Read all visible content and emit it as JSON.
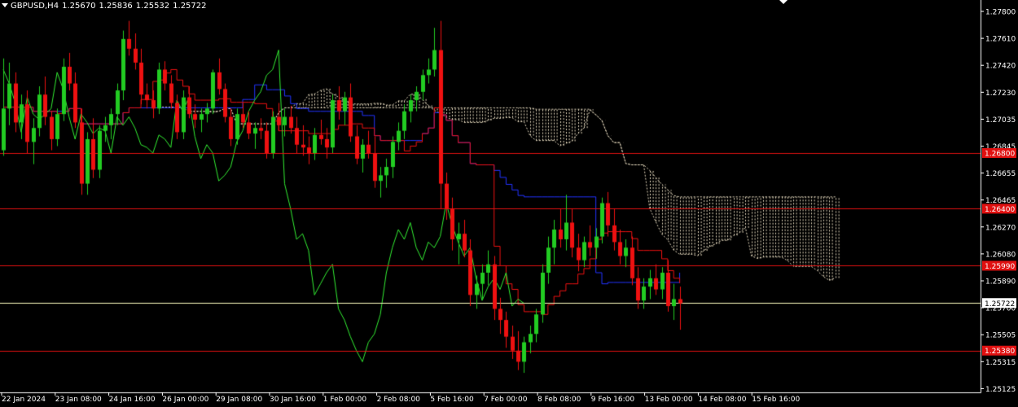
{
  "window": {
    "symbol": "GBPUSD,H4",
    "ohlc": [
      "1.25670",
      "1.25836",
      "1.25532",
      "1.25722"
    ]
  },
  "chart_data": {
    "type": "candlestick",
    "ylim": [
      1.2508,
      1.279
    ],
    "yticks": [
      "1.27800",
      "1.27610",
      "1.27420",
      "1.27230",
      "1.27035",
      "1.26845",
      "1.26655",
      "1.26465",
      "1.26270",
      "1.26080",
      "1.25890",
      "1.25700",
      "1.25505",
      "1.25315",
      "1.25125"
    ],
    "xticks": [
      "22 Jan 2024",
      "23 Jan 08:00",
      "24 Jan 16:00",
      "26 Jan 00:00",
      "29 Jan 08:00",
      "30 Jan 16:00",
      "1 Feb 00:00",
      "2 Feb 08:00",
      "5 Feb 16:00",
      "7 Feb 00:00",
      "8 Feb 08:00",
      "9 Feb 16:00",
      "13 Feb 00:00",
      "14 Feb 08:00",
      "15 Feb 16:00"
    ],
    "horizontal_levels": [
      {
        "value": 1.268,
        "label": "1.26800",
        "color": "#e01010"
      },
      {
        "value": 1.264,
        "label": "1.26400",
        "color": "#e01010"
      },
      {
        "value": 1.2599,
        "label": "1.25990",
        "color": "#e01010"
      },
      {
        "value": 1.2538,
        "label": "1.25380",
        "color": "#e01010"
      }
    ],
    "current_price": {
      "value": 1.25722,
      "label": "1.25722",
      "color": "#ffffc0"
    },
    "bullish_color": "#22cc22",
    "bearish_color": "#ee1111",
    "tenkan_color": "#ee1111",
    "kijun_color": "#2233ff",
    "chikou_color": "#33ee33",
    "cloud_color": "#e8dcc0",
    "candles": [
      [
        1.2682,
        1.2748,
        1.2678,
        1.2712
      ],
      [
        1.2712,
        1.2745,
        1.27,
        1.273
      ],
      [
        1.273,
        1.2738,
        1.2695,
        1.2702
      ],
      [
        1.2702,
        1.2722,
        1.269,
        1.2715
      ],
      [
        1.2715,
        1.2725,
        1.268,
        1.2688
      ],
      [
        1.2688,
        1.2705,
        1.2672,
        1.2698
      ],
      [
        1.2698,
        1.2728,
        1.2692,
        1.2722
      ],
      [
        1.2722,
        1.2735,
        1.27,
        1.2706
      ],
      [
        1.2706,
        1.271,
        1.2682,
        1.269
      ],
      [
        1.269,
        1.2712,
        1.2685,
        1.2708
      ],
      [
        1.2708,
        1.2748,
        1.2703,
        1.2742
      ],
      [
        1.2742,
        1.2752,
        1.2725,
        1.273
      ],
      [
        1.273,
        1.2738,
        1.2698,
        1.2702
      ],
      [
        1.2702,
        1.2712,
        1.265,
        1.2658
      ],
      [
        1.2658,
        1.2695,
        1.265,
        1.269
      ],
      [
        1.269,
        1.2705,
        1.2662,
        1.2668
      ],
      [
        1.2668,
        1.27,
        1.2662,
        1.2696
      ],
      [
        1.2696,
        1.2706,
        1.2688,
        1.27
      ],
      [
        1.27,
        1.2712,
        1.269,
        1.2708
      ],
      [
        1.2708,
        1.273,
        1.27,
        1.2725
      ],
      [
        1.2725,
        1.2768,
        1.2718,
        1.2762
      ],
      [
        1.2762,
        1.2775,
        1.275,
        1.2755
      ],
      [
        1.2755,
        1.2766,
        1.274,
        1.2745
      ],
      [
        1.2745,
        1.2755,
        1.2715,
        1.2722
      ],
      [
        1.2722,
        1.273,
        1.2712,
        1.2718
      ],
      [
        1.2718,
        1.2725,
        1.2705,
        1.2712
      ],
      [
        1.2712,
        1.2745,
        1.2708,
        1.274
      ],
      [
        1.274,
        1.2746,
        1.2725,
        1.273
      ],
      [
        1.273,
        1.2736,
        1.2712,
        1.2716
      ],
      [
        1.2716,
        1.2722,
        1.269,
        1.2695
      ],
      [
        1.2695,
        1.2725,
        1.269,
        1.272
      ],
      [
        1.272,
        1.2728,
        1.2705,
        1.2708
      ],
      [
        1.2708,
        1.2715,
        1.2698,
        1.2704
      ],
      [
        1.2704,
        1.2712,
        1.2695,
        1.2708
      ],
      [
        1.2708,
        1.2716,
        1.2702,
        1.2712
      ],
      [
        1.2712,
        1.274,
        1.2708,
        1.2738
      ],
      [
        1.2738,
        1.2748,
        1.2722,
        1.2726
      ],
      [
        1.2726,
        1.273,
        1.2702,
        1.2706
      ],
      [
        1.2706,
        1.2712,
        1.2685,
        1.269
      ],
      [
        1.269,
        1.2712,
        1.2686,
        1.2708
      ],
      [
        1.2708,
        1.2716,
        1.2698,
        1.2702
      ],
      [
        1.2702,
        1.271,
        1.269,
        1.2694
      ],
      [
        1.2694,
        1.2702,
        1.2683,
        1.2698
      ],
      [
        1.2698,
        1.2705,
        1.269,
        1.2696
      ],
      [
        1.2696,
        1.2702,
        1.2676,
        1.268
      ],
      [
        1.268,
        1.271,
        1.2676,
        1.2706
      ],
      [
        1.2706,
        1.2716,
        1.2696,
        1.27
      ],
      [
        1.27,
        1.2712,
        1.2692,
        1.2706
      ],
      [
        1.2706,
        1.2714,
        1.2694,
        1.2698
      ],
      [
        1.2698,
        1.2706,
        1.268,
        1.2686
      ],
      [
        1.2686,
        1.27,
        1.2678,
        1.2684
      ],
      [
        1.2684,
        1.2692,
        1.2672,
        1.268
      ],
      [
        1.268,
        1.2698,
        1.2675,
        1.2693
      ],
      [
        1.2693,
        1.2704,
        1.2686,
        1.269
      ],
      [
        1.269,
        1.2698,
        1.2676,
        1.2684
      ],
      [
        1.2684,
        1.2722,
        1.268,
        1.2718
      ],
      [
        1.2718,
        1.2728,
        1.2704,
        1.271
      ],
      [
        1.271,
        1.2724,
        1.27,
        1.272
      ],
      [
        1.272,
        1.273,
        1.2688,
        1.2692
      ],
      [
        1.2692,
        1.27,
        1.2672,
        1.2676
      ],
      [
        1.2676,
        1.269,
        1.2666,
        1.2686
      ],
      [
        1.2686,
        1.2696,
        1.2676,
        1.268
      ],
      [
        1.268,
        1.2692,
        1.2655,
        1.266
      ],
      [
        1.266,
        1.267,
        1.2648,
        1.2664
      ],
      [
        1.2664,
        1.2676,
        1.2655,
        1.267
      ],
      [
        1.267,
        1.2692,
        1.2662,
        1.2688
      ],
      [
        1.2688,
        1.2702,
        1.2682,
        1.2696
      ],
      [
        1.2696,
        1.2715,
        1.269,
        1.271
      ],
      [
        1.271,
        1.2722,
        1.2702,
        1.2718
      ],
      [
        1.2718,
        1.2728,
        1.271,
        1.2724
      ],
      [
        1.2724,
        1.274,
        1.2718,
        1.2736
      ],
      [
        1.2736,
        1.2748,
        1.273,
        1.274
      ],
      [
        1.274,
        1.277,
        1.2735,
        1.2754
      ],
      [
        1.2754,
        1.2775,
        1.264,
        1.2658
      ],
      [
        1.2658,
        1.2666,
        1.2632,
        1.264
      ],
      [
        1.264,
        1.2648,
        1.261,
        1.2618
      ],
      [
        1.2618,
        1.263,
        1.26,
        1.2622
      ],
      [
        1.2622,
        1.2632,
        1.2605,
        1.261
      ],
      [
        1.261,
        1.2618,
        1.257,
        1.2578
      ],
      [
        1.2578,
        1.2592,
        1.2568,
        1.2586
      ],
      [
        1.2586,
        1.26,
        1.2575,
        1.2594
      ],
      [
        1.2594,
        1.261,
        1.2585,
        1.26
      ],
      [
        1.26,
        1.2606,
        1.256,
        1.2568
      ],
      [
        1.2568,
        1.2576,
        1.255,
        1.256
      ],
      [
        1.256,
        1.2566,
        1.254,
        1.2548
      ],
      [
        1.2548,
        1.2556,
        1.2532,
        1.2538
      ],
      [
        1.2538,
        1.2552,
        1.2524,
        1.253
      ],
      [
        1.253,
        1.2548,
        1.2522,
        1.2544
      ],
      [
        1.2544,
        1.2556,
        1.2536,
        1.255
      ],
      [
        1.255,
        1.2568,
        1.2544,
        1.2564
      ],
      [
        1.2564,
        1.26,
        1.2558,
        1.2594
      ],
      [
        1.2594,
        1.262,
        1.2586,
        1.2612
      ],
      [
        1.2612,
        1.2632,
        1.26,
        1.2625
      ],
      [
        1.2625,
        1.264,
        1.2612,
        1.2618
      ],
      [
        1.2618,
        1.265,
        1.261,
        1.263
      ],
      [
        1.263,
        1.264,
        1.2605,
        1.2612
      ],
      [
        1.2612,
        1.2622,
        1.2595,
        1.2603
      ],
      [
        1.2603,
        1.262,
        1.2598,
        1.2616
      ],
      [
        1.2616,
        1.2628,
        1.2606,
        1.2612
      ],
      [
        1.2612,
        1.2626,
        1.2604,
        1.262
      ],
      [
        1.262,
        1.2648,
        1.2615,
        1.2644
      ],
      [
        1.2644,
        1.2652,
        1.262,
        1.2628
      ],
      [
        1.2628,
        1.264,
        1.261,
        1.2616
      ],
      [
        1.2616,
        1.2625,
        1.26,
        1.2606
      ],
      [
        1.2606,
        1.2618,
        1.2598,
        1.2612
      ],
      [
        1.2612,
        1.262,
        1.2585,
        1.259
      ],
      [
        1.259,
        1.2598,
        1.2568,
        1.2574
      ],
      [
        1.2574,
        1.259,
        1.2568,
        1.2584
      ],
      [
        1.2584,
        1.2596,
        1.2575,
        1.259
      ],
      [
        1.259,
        1.26,
        1.2578,
        1.2582
      ],
      [
        1.2582,
        1.2598,
        1.2575,
        1.2594
      ],
      [
        1.2594,
        1.2603,
        1.2566,
        1.257
      ],
      [
        1.257,
        1.2586,
        1.256,
        1.2575
      ],
      [
        1.2575,
        1.2584,
        1.2553,
        1.2572
      ]
    ]
  }
}
